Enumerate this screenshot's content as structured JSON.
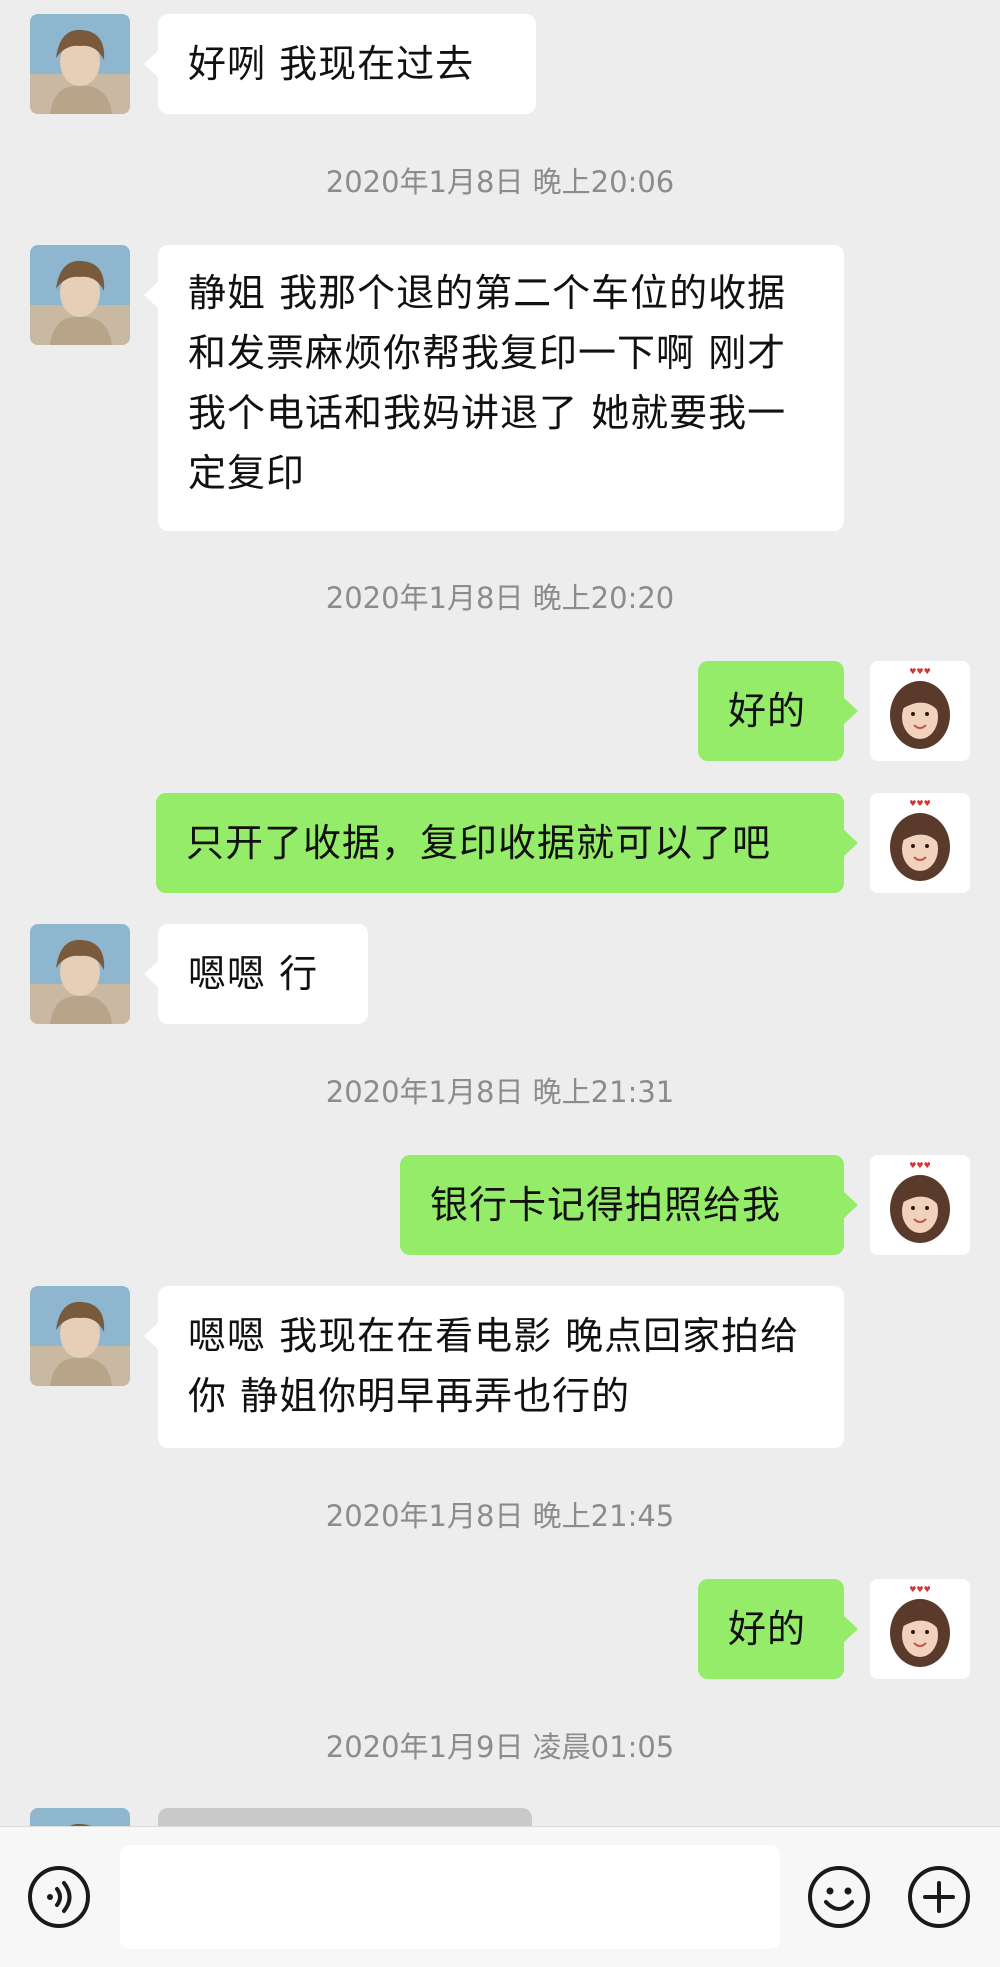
{
  "messages": [
    {
      "dir": "in",
      "text": "好咧 我现在过去"
    },
    {
      "time": "2020年1月8日 晚上20:06"
    },
    {
      "dir": "in",
      "text": "静姐 我那个退的第二个车位的收据和发票麻烦你帮我复印一下啊 刚才我个电话和我妈讲退了 她就要我一定复印"
    },
    {
      "time": "2020年1月8日 晚上20:20"
    },
    {
      "dir": "out",
      "text": "好的"
    },
    {
      "dir": "out",
      "text": "只开了收据，复印收据就可以了吧"
    },
    {
      "dir": "in",
      "text": "嗯嗯 行"
    },
    {
      "time": "2020年1月8日 晚上21:31"
    },
    {
      "dir": "out",
      "text": "银行卡记得拍照给我"
    },
    {
      "dir": "in",
      "text": "嗯嗯 我现在在看电影 晚点回家拍给你 静姐你明早再弄也行的"
    },
    {
      "time": "2020年1月8日 晚上21:45"
    },
    {
      "dir": "out",
      "text": "好的"
    },
    {
      "time": "2020年1月9日 凌晨01:05"
    }
  ],
  "toolbar": {
    "left_icon": "voice-icon",
    "emoji_icon": "emoji-icon",
    "plus_icon": "plus-icon",
    "input_value": ""
  },
  "colors": {
    "background": "#ededed",
    "incoming_bubble": "#ffffff",
    "outgoing_bubble": "#95ec69",
    "timestamp": "#8c8c8c"
  }
}
